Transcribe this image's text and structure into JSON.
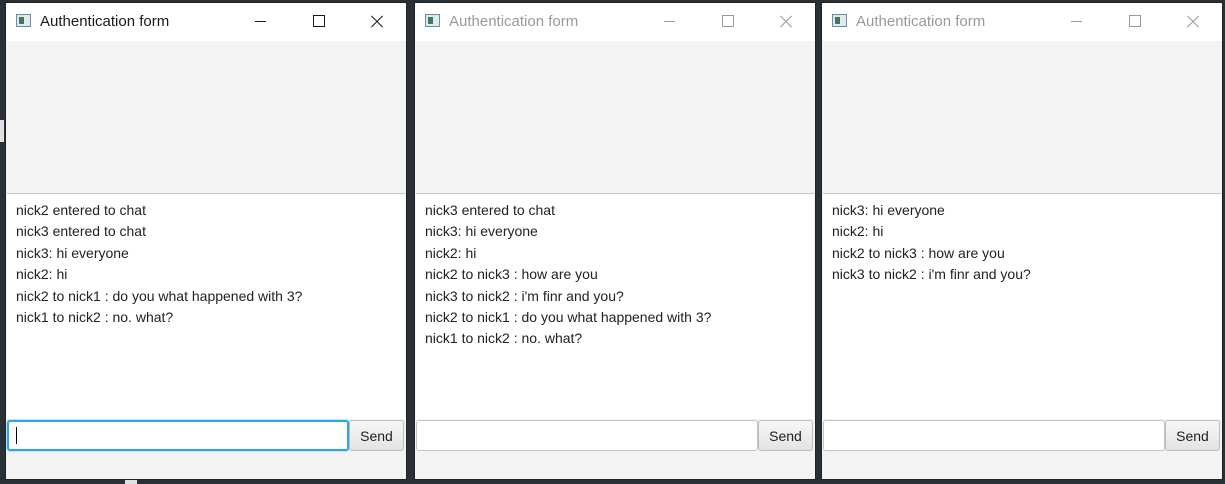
{
  "windows": [
    {
      "title": "Authentication form",
      "active": true,
      "messages": [
        "nick2 entered to chat",
        "nick3 entered to chat",
        "nick3: hi everyone",
        "nick2: hi",
        "nick2 to nick1 : do you what happened with 3?",
        "nick1 to nick2 : no. what?"
      ],
      "input_value": "",
      "send_label": "Send"
    },
    {
      "title": "Authentication form",
      "active": false,
      "messages": [
        "nick3 entered to chat",
        "nick3: hi everyone",
        "nick2: hi",
        "nick2 to nick3 : how are you",
        "nick3 to nick2 : i'm finr and you?",
        "nick2 to nick1 : do you what happened with 3?",
        "nick1 to nick2 : no. what?"
      ],
      "input_value": "",
      "send_label": "Send"
    },
    {
      "title": "Authentication form",
      "active": false,
      "messages": [
        "nick3: hi everyone",
        "nick2: hi",
        "nick2 to nick3 : how are you",
        "nick3 to nick2 : i'm finr and you?"
      ],
      "input_value": "",
      "send_label": "Send"
    }
  ],
  "icons": {
    "app": "app-window-icon",
    "minimize": "minimize-icon",
    "maximize": "maximize-icon",
    "close": "close-icon"
  },
  "colors": {
    "focus_border": "#2fa6e0",
    "desktop": "#2b2f36"
  }
}
